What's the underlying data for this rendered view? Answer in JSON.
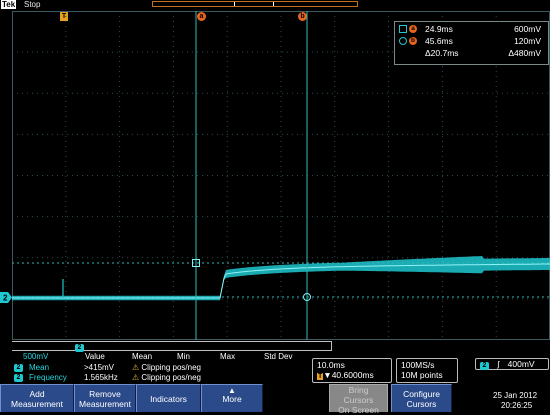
{
  "top": {
    "brand": "Tek",
    "run_state": "Stop",
    "trigger_marker": "T",
    "cursor_a_marker": "a",
    "cursor_b_marker": "b"
  },
  "cursor_readout": {
    "a": {
      "label": "a",
      "time": "24.9ms",
      "voltage": "600mV"
    },
    "b": {
      "label": "b",
      "time": "45.6ms",
      "voltage": "120mV"
    },
    "delta": {
      "time": "Δ20.7ms",
      "voltage": "Δ480mV"
    }
  },
  "channel": {
    "number": "2",
    "scale": "500mV",
    "ground_marker": "2"
  },
  "measurements": {
    "headers": [
      "Value",
      "Mean",
      "Min",
      "Max",
      "Std Dev"
    ],
    "rows": [
      {
        "channel": "2",
        "name": "Mean",
        "value": ">415mV",
        "status": "Clipping pos/neg"
      },
      {
        "channel": "2",
        "name": "Frequency",
        "value": "1.565kHz",
        "status": "Clipping pos/neg"
      }
    ]
  },
  "horizontal": {
    "scale": "10.0ms",
    "position": "▼40.6000ms"
  },
  "acquisition": {
    "sample_rate": "100MS/s",
    "record_length": "10M points"
  },
  "trigger": {
    "channel": "2",
    "slope": "ʃ",
    "level": "400mV"
  },
  "datetime": {
    "date": "25 Jan  2012",
    "time": "20:26:25"
  },
  "buttons": {
    "add_measurement": [
      "Add",
      "Measurement"
    ],
    "remove_measurement": [
      "Remove",
      "Measurement"
    ],
    "indicators": "Indicators",
    "more": "More",
    "bring_cursors": [
      "Bring",
      "Cursors",
      "On Screen"
    ],
    "configure_cursors": [
      "Configure",
      "Cursors"
    ]
  },
  "colors": {
    "trace": "#1ec8d0",
    "cursor_marker": "#e8651e",
    "button": "#2a4a8a",
    "grid": "#2a4a50"
  }
}
